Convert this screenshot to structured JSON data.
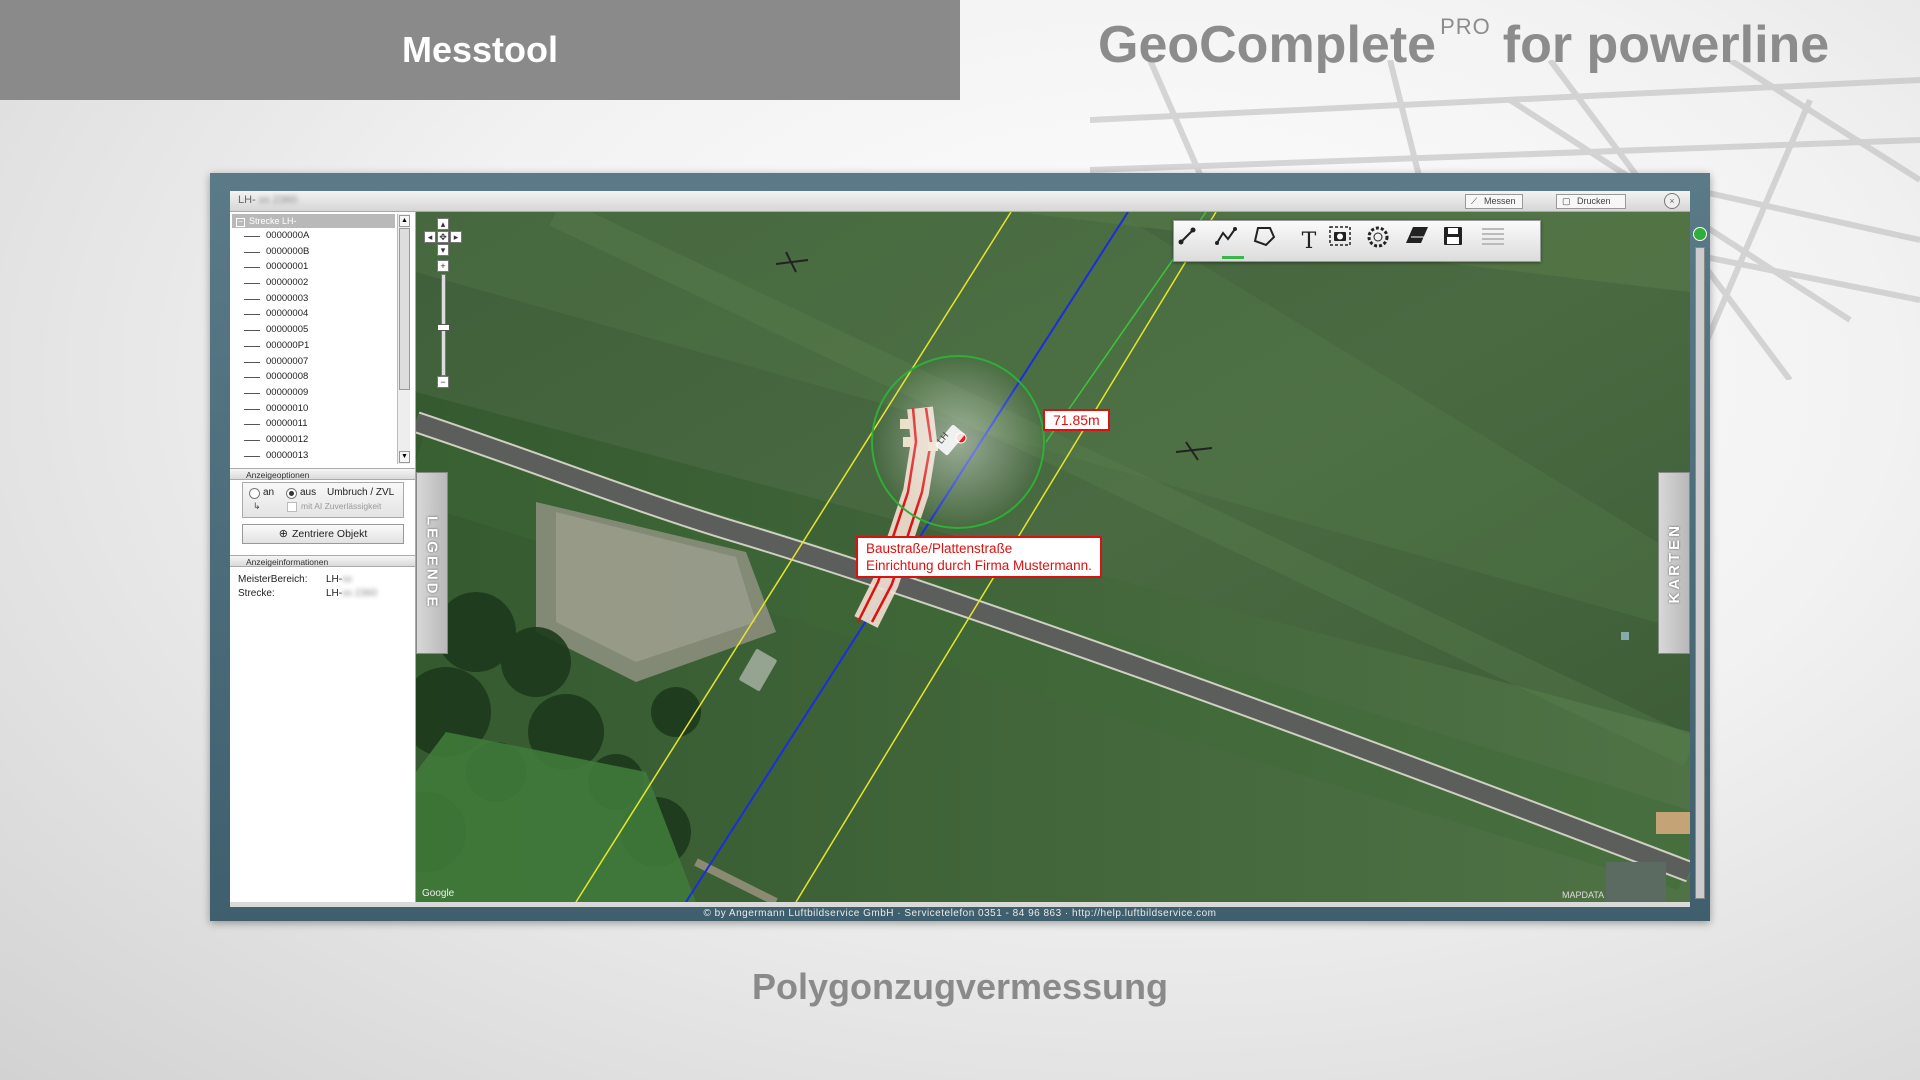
{
  "header": {
    "section_title": "Messtool",
    "brand_main": "GeoComplete",
    "brand_sup": "PRO",
    "brand_suffix": "for powerline"
  },
  "caption": "Polygonzugvermessung",
  "window": {
    "doc_title": "LH-",
    "measure_button": "Messen",
    "print_button": "Drucken"
  },
  "tree": {
    "root_label": "Strecke LH-",
    "items": [
      "0000000A",
      "0000000B",
      "00000001",
      "00000002",
      "00000003",
      "00000004",
      "00000005",
      "000000P1",
      "00000007",
      "00000008",
      "00000009",
      "00000010",
      "00000011",
      "00000012",
      "00000013"
    ]
  },
  "display_options": {
    "header": "Anzeigeoptionen",
    "on_label": "an",
    "off_label": "aus",
    "option_label": "Umbruch / ZVL",
    "sub_option": "mit AI Zuverlässigkeit",
    "selected": "aus"
  },
  "center_button": "Zentriere Objekt",
  "display_info": {
    "header": "Anzeigeinformationen",
    "master_label": "MeisterBereich:",
    "master_value": "LH-",
    "route_label": "Strecke:",
    "route_value": "LH-"
  },
  "map": {
    "measure_value": "71.85m",
    "note_line1": "Baustraße/Plattenstraße",
    "note_line2": "Einrichtung durch Firma Mustermann.",
    "left_tab": "LEGENDE",
    "right_tab": "KARTEN",
    "pylon_label": "LH",
    "google": "Google",
    "credit": "MAPDATA"
  },
  "toolbar": {
    "tools": [
      "line-tool-icon",
      "polyline-tool-icon",
      "polygon-tool-icon",
      "text-tool-icon",
      "screenshot-tool-icon",
      "circle-tool-icon",
      "eraser-tool-icon",
      "save-icon",
      "list-icon"
    ],
    "active": "polyline-tool-icon"
  },
  "status_bar": "©  by Angermann Luftbildservice GmbH   ·   Servicetelefon 0351 - 84 96 863   ·   http://help.luftbildservice.com",
  "colors": {
    "header_bg": "#8a8a8a",
    "measure_red": "#dd1111",
    "powerline_blue": "#1a2ee0",
    "buffer_yellow": "#e6e62a",
    "buffer_green": "#3cc43c",
    "active_green": "#3ab54a"
  }
}
